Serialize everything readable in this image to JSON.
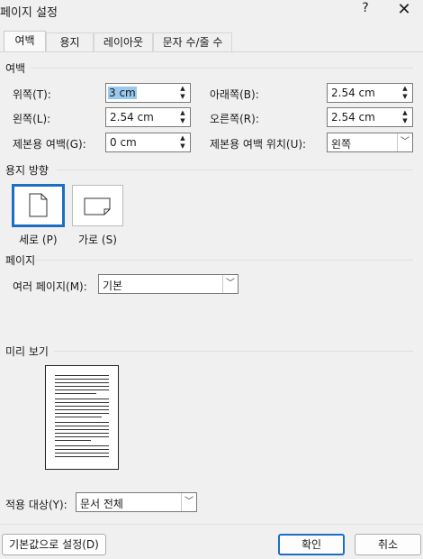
{
  "window": {
    "title": "페이지 설정",
    "help": "?",
    "close": "✕"
  },
  "tabs": [
    "여백",
    "용지",
    "레이아웃",
    "문자 수/줄 수"
  ],
  "margins": {
    "group_label": "여백",
    "top_label": "위쪽(T):",
    "top_value": "3 cm",
    "bottom_label": "아래쪽(B):",
    "bottom_value": "2.54 cm",
    "left_label": "왼쪽(L):",
    "left_value": "2.54 cm",
    "right_label": "오른쪽(R):",
    "right_value": "2.54 cm",
    "gutter_label": "제본용 여백(G):",
    "gutter_value": "0 cm",
    "gutter_pos_label": "제본용 여백 위치(U):",
    "gutter_pos_value": "왼쪽"
  },
  "orientation": {
    "group_label": "용지 방향",
    "portrait_label": "세로 (P)",
    "landscape_label": "가로 (S)",
    "selected": "portrait"
  },
  "pages": {
    "group_label": "페이지",
    "multiple_label": "여러 페이지(M):",
    "multiple_value": "기본"
  },
  "preview": {
    "group_label": "미리 보기"
  },
  "apply": {
    "label": "적용 대상(Y):",
    "value": "문서 전체"
  },
  "buttons": {
    "default": "기본값으로 설정(D)",
    "ok": "확인",
    "cancel": "취소"
  },
  "colors": {
    "accent": "#1a6fc2",
    "selection": "#99c9ef",
    "background": "#f0f0f0"
  }
}
